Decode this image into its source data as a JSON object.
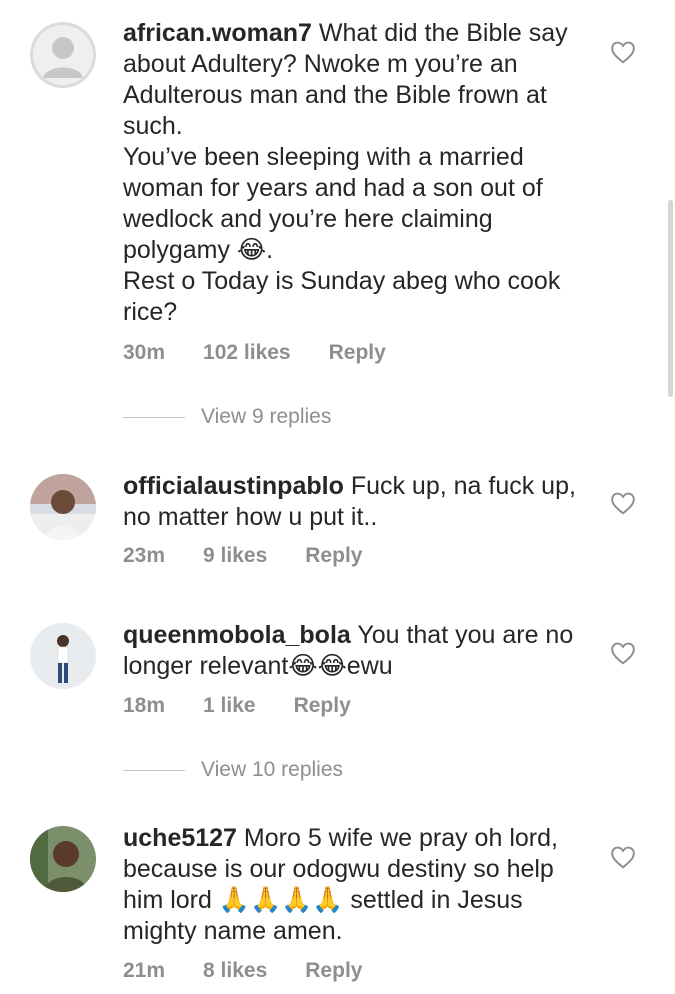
{
  "comments": [
    {
      "username": "african.woman7",
      "text_lines": [
        "What did the Bible say about Adultery? Nwoke m you’re an Adulterous man and the Bible frown at such.",
        "You’ve been sleeping with a married woman for years and had a son out of wedlock and you’re here claiming polygamy 😂.",
        "Rest o Today is Sunday abeg who cook rice?"
      ],
      "time": "30m",
      "likes": "102 likes",
      "reply": "Reply",
      "view_replies": "View 9 replies"
    },
    {
      "username": "officialaustinpablo",
      "text_lines": [
        "Fuck up, na fuck up, no matter how u put it.."
      ],
      "time": "23m",
      "likes": "9 likes",
      "reply": "Reply"
    },
    {
      "username": "queenmobola_bola",
      "text_lines": [
        "You that you are no longer relevant😂😂ewu"
      ],
      "time": "18m",
      "likes": "1 like",
      "reply": "Reply",
      "view_replies": "View 10 replies"
    },
    {
      "username": "uche5127",
      "text_lines": [
        "Moro 5 wife we pray oh lord, because is our odogwu destiny so help him lord 🙏🙏🙏🙏 settled in Jesus mighty name amen."
      ],
      "time": "21m",
      "likes": "8 likes",
      "reply": "Reply"
    }
  ],
  "icons": {
    "like": "heart-outline-icon",
    "avatar_default": "default-user-icon"
  },
  "colors": {
    "text": "#262626",
    "meta": "#8e8e8e",
    "divider": "#c7c7c7"
  }
}
